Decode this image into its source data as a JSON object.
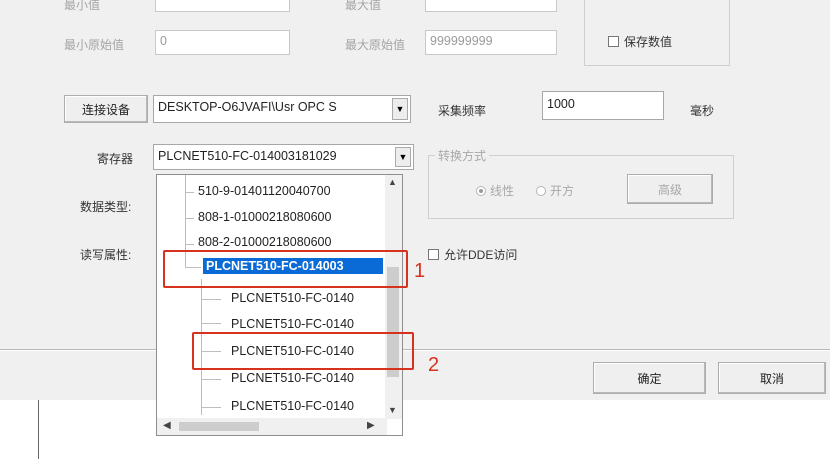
{
  "top": {
    "row0_left_label": "最小值",
    "row0_right_label": "最大值",
    "min_raw_label": "最小原始值",
    "min_raw_value": "0",
    "max_raw_label": "最大原始值",
    "max_raw_value": "999999999",
    "save_data_label": "保存数值"
  },
  "connect": {
    "button_label": "连接设备",
    "server_value": "DESKTOP-O6JVAFI\\Usr OPC S",
    "rate_label": "采集频率",
    "rate_value": "1000",
    "rate_unit": "毫秒"
  },
  "register": {
    "label": "寄存器",
    "value": "PLCNET510-FC-014003181029"
  },
  "data_type_label": "数据类型:",
  "rw_label": "读写属性:",
  "convert": {
    "caption": "转换方式",
    "linear_label": "线性",
    "linear_selected": true,
    "sqrt_label": "开方",
    "advanced_label": "高级"
  },
  "allow_dde_label": "允许DDE访问",
  "tree_items": [
    "510-9-01401120040700",
    "808-1-01000218080600",
    "808-2-01000218080600",
    "PLCNET510-FC-014003",
    "PLCNET510-FC-0140",
    "PLCNET510-FC-0140",
    "PLCNET510-FC-0140",
    "PLCNET510-FC-0140",
    "PLCNET510-FC-0140"
  ],
  "callouts": {
    "first": "1",
    "second": "2"
  },
  "footer": {
    "ok_label": "确定",
    "cancel_label": "取消"
  },
  "colors": {
    "selection": "#0a6ad6",
    "callout": "#d7321e"
  }
}
